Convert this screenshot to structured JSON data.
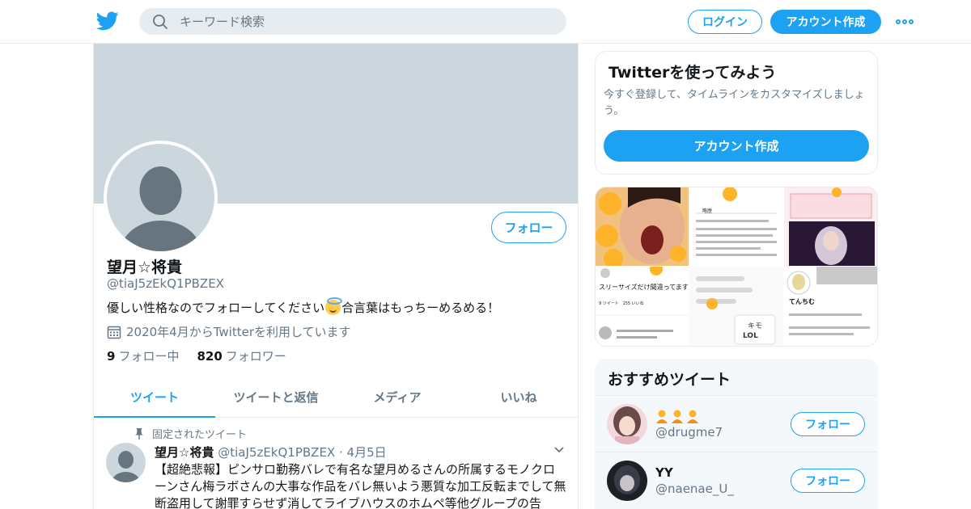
{
  "header": {
    "search_placeholder": "キーワード検索",
    "login_label": "ログイン",
    "signup_label": "アカウント作成",
    "icons": [
      "twitter-logo",
      "search-icon",
      "more-icon"
    ]
  },
  "profile": {
    "follow_label": "フォロー",
    "name": "望月☆将貴",
    "handle": "@tiaJ5zEkQ1PBZEX",
    "bio_part1": "優しい性格なのでフォローしてください",
    "bio_part2": "合言葉はもっちーめるめる！",
    "joined": "2020年4月からTwitterを利用しています",
    "following_count": "9",
    "following_label": "フォロー中",
    "followers_count": "820",
    "followers_label": "フォロワー"
  },
  "tabs": [
    {
      "label": "ツイート",
      "active": true
    },
    {
      "label": "ツイートと返信",
      "active": false
    },
    {
      "label": "メディア",
      "active": false
    },
    {
      "label": "いいね",
      "active": false
    }
  ],
  "tweet": {
    "pinned_label": "固定されたツイート",
    "author_name": "望月☆将貴",
    "author_handle": "@tiaJ5zEkQ1PBZEX",
    "separator": "·",
    "date": "4月5日",
    "text": "【超絶悲報】ピンサロ勤務バレで有名な望月めるさんの所属するモノクローンさん梅ラボさんの大事な作品をバレ無いよう悪質な加工反転までして無断盗用して謝罪すらせず消してライブハウスのホムペ等他グループの告"
  },
  "sidebar": {
    "signup_box": {
      "title": "Twitterを使ってみよう",
      "description": "今すぐ登録して、タイムラインをカスタマイズしましょう。",
      "button_label": "アカウント作成"
    },
    "media_texts": {
      "history": "略歴",
      "tweet_caption": "スリーサイズだけ間違ってます...",
      "tenchimu": "てんちむ",
      "counts": "9 ツイート   155 いいね"
    },
    "recommended": {
      "title": "おすすめツイート",
      "accounts": [
        {
          "name": "",
          "handle": "@drugme7",
          "follow_label": "フォロー"
        },
        {
          "name": "YY",
          "handle": "@naenae_U_",
          "follow_label": "フォロー"
        }
      ]
    }
  },
  "colors": {
    "accent": "#1da1f2",
    "banner": "#ccd6dd",
    "secondary_text": "#657786",
    "border": "#e6ecf0"
  }
}
